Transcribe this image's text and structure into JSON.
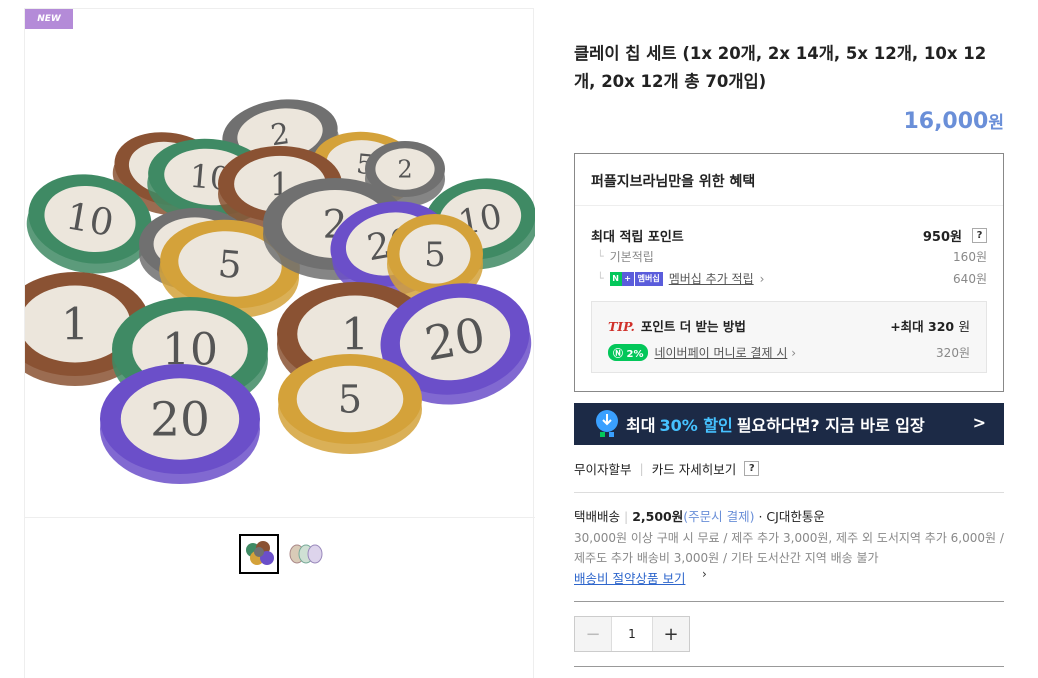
{
  "badge": "NEW",
  "product": {
    "title": "클레이 칩 세트 (1x 20개, 2x 14개, 5x 12개, 10x 12개, 20x 12개 총 70개입)",
    "price": "16,000",
    "currency": "원"
  },
  "chips": [
    {
      "label": "10",
      "color": "#3f8a64"
    },
    {
      "label": "1",
      "color": "#8a5233"
    },
    {
      "label": "5",
      "color": "#d4a23a"
    },
    {
      "label": "2",
      "color": "#707070"
    },
    {
      "label": "20",
      "color": "#6b4fc9"
    }
  ],
  "benefit": {
    "header": "퍼플지브라님만을 위한 혜택",
    "max_points_label": "최대 적립 포인트",
    "max_points_value": "950원",
    "help": "?",
    "base_label": "기본적립",
    "base_value": "160원",
    "membership_badge": "멤버십",
    "membership_label": "멤버십 추가 적립",
    "membership_value": "640원",
    "tip_label": "TIP.",
    "tip_text": "포인트 더 받는 방법",
    "tip_max_prefix": "+최대",
    "tip_max_value": "320",
    "tip_max_unit": "원",
    "npay_pct": "2%",
    "npay_label": "네이버페이 머니로 결제 시",
    "npay_value": "320원"
  },
  "banner": {
    "pre": "최대",
    "highlight": "30% 할인",
    "post": "필요하다면? 지금 바로 입장",
    "chevron": ">"
  },
  "payment": {
    "installment": "무이자할부",
    "card_details": "카드 자세히보기",
    "help": "?"
  },
  "shipping": {
    "method": "택배배송",
    "fee": "2,500원",
    "fee_note": "(주문시 결제)",
    "carrier": "· CJ대한통운",
    "note": "30,000원 이상 구매 시 무료 / 제주 추가 3,000원, 제주 외 도서지역 추가 6,000원 / 제주도 추가 배송비 3,000원 / 기타 도서산간 지역 배송 불가",
    "link": "배송비 절약상품 보기"
  },
  "quantity": {
    "minus": "−",
    "value": "1",
    "plus": "+"
  }
}
